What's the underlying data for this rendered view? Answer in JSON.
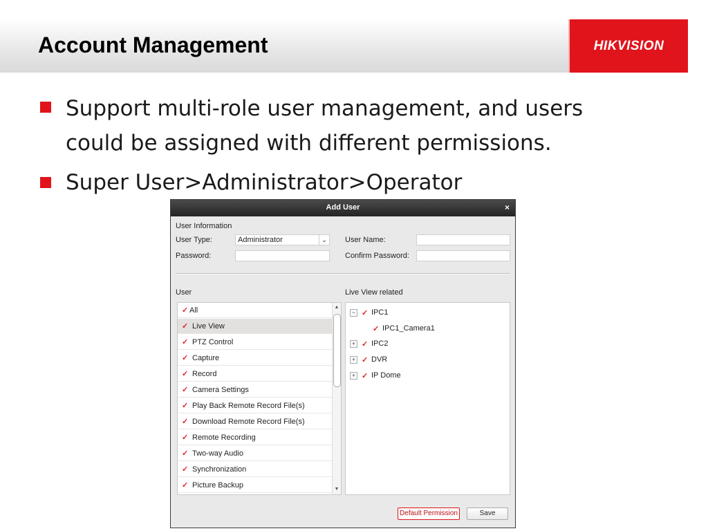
{
  "slide": {
    "title": "Account Management",
    "logo_text": "HIKVISION",
    "bullets": [
      {
        "line1": "Support multi-role user management, and users",
        "line2": "could be assigned with different permissions."
      },
      {
        "line1": "Super User>Administrator>Operator"
      }
    ]
  },
  "dialog": {
    "title": "Add User",
    "close_icon": "×",
    "user_information_label": "User Information",
    "user_type_label": "User Type:",
    "user_type_value": "Administrator",
    "user_name_label": "User Name:",
    "user_name_value": "",
    "password_label": "Password:",
    "password_value": "",
    "confirm_password_label": "Confirm Password:",
    "confirm_password_value": "",
    "user_section_label": "User",
    "live_view_section_label": "Live View related",
    "permissions": [
      {
        "label": "All",
        "checked": true
      },
      {
        "label": "Live View",
        "checked": true,
        "selected": true
      },
      {
        "label": "PTZ Control",
        "checked": true
      },
      {
        "label": "Capture",
        "checked": true
      },
      {
        "label": "Record",
        "checked": true
      },
      {
        "label": "Camera Settings",
        "checked": true
      },
      {
        "label": "Play Back Remote Record File(s)",
        "checked": true
      },
      {
        "label": "Download Remote Record File(s)",
        "checked": true
      },
      {
        "label": "Remote Recording",
        "checked": true
      },
      {
        "label": "Two-way Audio",
        "checked": true
      },
      {
        "label": "Synchronization",
        "checked": true
      },
      {
        "label": "Picture Backup",
        "checked": true
      }
    ],
    "tree": [
      {
        "label": "IPC1",
        "expander": "−",
        "checked": true
      },
      {
        "label": "IPC1_Camera1",
        "expander": "",
        "checked": true
      },
      {
        "label": "IPC2",
        "expander": "+",
        "checked": true
      },
      {
        "label": "DVR",
        "expander": "+",
        "checked": true
      },
      {
        "label": "IP Dome",
        "expander": "+",
        "checked": true
      }
    ],
    "default_permission_label": "Default Permission",
    "save_label": "Save"
  },
  "colors": {
    "brand_red": "#e1141b",
    "check_red": "#dd2222"
  },
  "icons": {
    "bullet": "red-square-icon",
    "check": "checkmark-icon",
    "dropdown": "chevron-down-icon"
  }
}
